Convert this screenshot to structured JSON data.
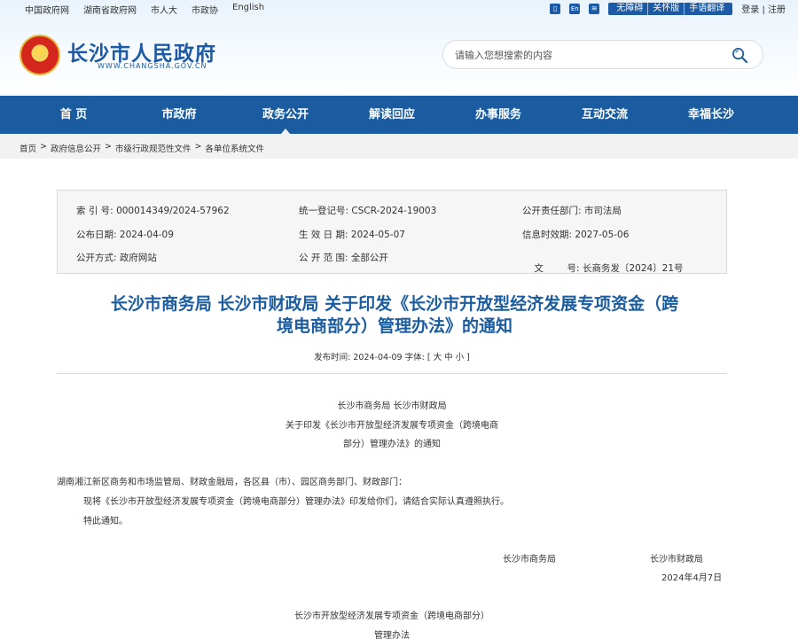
{
  "top_links": [
    "中国政府网",
    "湖南省政府网",
    "市人大",
    "市政协",
    "English"
  ],
  "top_right": {
    "icons": [
      "phone-icon",
      "en-icon",
      "rss-icon"
    ],
    "icon_glyphs": [
      "▯",
      "En",
      "≋"
    ],
    "accessibility": [
      "无障碍",
      "关怀版",
      "手语翻译"
    ],
    "login": "登录",
    "separator": "|",
    "register": "注册"
  },
  "site": {
    "title": "长沙市人民政府",
    "url": "WWW.CHANGSHA.GOV.CN"
  },
  "search": {
    "placeholder": "请输入您想搜索的内容"
  },
  "nav": [
    "首  页",
    "市政府",
    "政务公开",
    "解读回应",
    "办事服务",
    "互动交流",
    "幸福长沙"
  ],
  "nav_active_index": 2,
  "breadcrumb": [
    "首页",
    "政府信息公开",
    "市级行政规范性文件",
    "各单位系统文件"
  ],
  "breadcrumb_separator": ">",
  "meta": {
    "index_label": "索 引 号:",
    "index_value": "000014349/2024-57962",
    "reg_label": "统一登记号:",
    "reg_value": "CSCR-2024-19003",
    "dept_label": "公开责任部门:",
    "dept_value": "市司法局",
    "pubdate_label": "公布日期:",
    "pubdate_value": "2024-04-09",
    "effective_label": "生 效 日 期:",
    "effective_value": "2024-05-07",
    "validity_label": "信息时效期:",
    "validity_value": "2027-05-06",
    "method_label": "公开方式:",
    "method_value": "政府网站",
    "scope_label": "公 开 范 围:",
    "scope_value": "全部公开",
    "docno_label": "文        号:",
    "docno_value": "长商务发〔2024〕21号"
  },
  "document": {
    "title_line1": "长沙市商务局 长沙市财政局 关于印发《长沙市开放型经济发展专项资金（跨",
    "title_line2": "境电商部分）管理办法》的通知",
    "pub_time_label": "发布时间:",
    "pub_time": "2024-04-09",
    "font_label": "字体:",
    "font_sizes": "[ 大 中 小 ]",
    "heading_1": "长沙市商务局 长沙市财政局",
    "heading_2": "关于印发《长沙市开放型经济发展专项资金（跨境电商",
    "heading_3": "部分）管理办法》的通知",
    "recipients": "湖南湘江新区商务和市场监管局、财政金融局，各区县（市）、园区商务部门、财政部门：",
    "para_1": "现将《长沙市开放型经济发展专项资金（跨境电商部分）管理办法》印发给你们，请结合实际认真遵照执行。",
    "para_2": "特此通知。",
    "signer_1": "长沙市商务局",
    "signer_2": "长沙市财政局",
    "date": "2024年4月7日",
    "attachment_title_1": "长沙市开放型经济发展专项资金（跨境电商部分）",
    "attachment_title_2": "管理办法"
  },
  "colors": {
    "brand_blue": "#1a5c9f",
    "nav_bg": "#1a5c9f",
    "title_blue": "#1a5c9f"
  }
}
